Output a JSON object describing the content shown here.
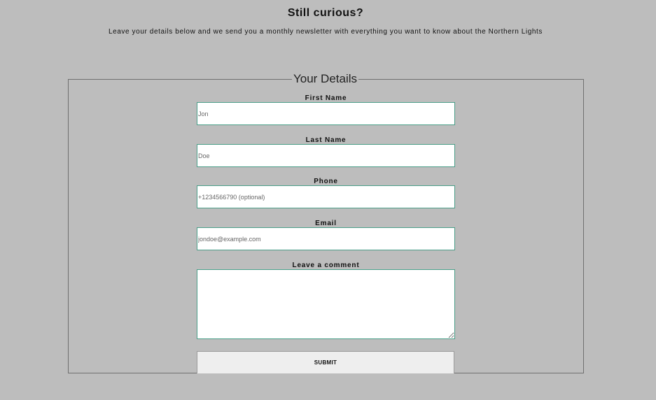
{
  "header": {
    "title": "Still curious?",
    "subtitle": "Leave your details below and we send you a monthly newsletter with everything you want to know about the Northern Lights"
  },
  "form": {
    "legend": "Your Details",
    "fields": [
      {
        "label": "First Name",
        "placeholder": "Jon"
      },
      {
        "label": "Last Name",
        "placeholder": "Doe"
      },
      {
        "label": "Phone",
        "placeholder": "+1234566790 (optional)"
      },
      {
        "label": "Email",
        "placeholder": "jondoe@example.com"
      },
      {
        "label": "Leave a comment",
        "placeholder": ""
      }
    ],
    "submit_label": "SUBMIT"
  },
  "colors": {
    "background": "#bdbdbd",
    "input_border": "#4a9e88"
  }
}
